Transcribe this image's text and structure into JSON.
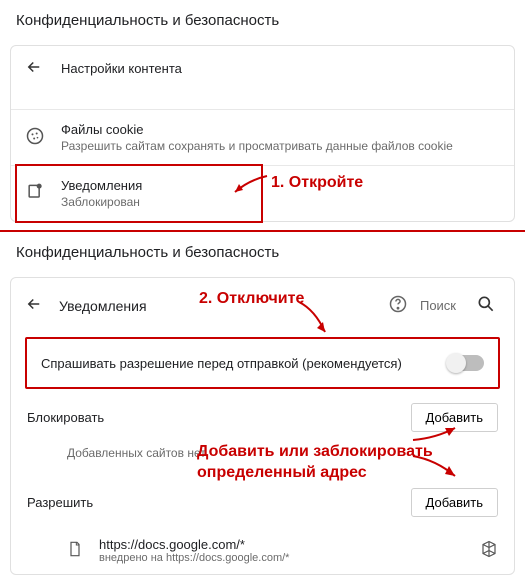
{
  "section1": {
    "header": "Конфиденциальность и безопасность",
    "back_label": "Настройки контента",
    "cookies": {
      "title": "Файлы cookie",
      "subtitle": "Разрешить сайтам сохранять и просматривать данные файлов cookie"
    },
    "notifications": {
      "title": "Уведомления",
      "subtitle": "Заблокирован"
    }
  },
  "annotations": {
    "step1": "1. Откройте",
    "step2": "2. Отключите",
    "step3a": "Добавить или заблокировать",
    "step3b": "определенный адрес"
  },
  "section2": {
    "header": "Конфиденциальность и безопасность",
    "back_label": "Уведомления",
    "search_text": "Поиск",
    "toggle_label": "Спрашивать разрешение перед отправкой (рекомендуется)",
    "block_label": "Блокировать",
    "add_button": "Добавить",
    "empty_text": "Добавленных сайтов нет",
    "allow_label": "Разрешить",
    "site_url": "https://docs.google.com/*",
    "site_sub": "внедрено на https://docs.google.com/*"
  }
}
